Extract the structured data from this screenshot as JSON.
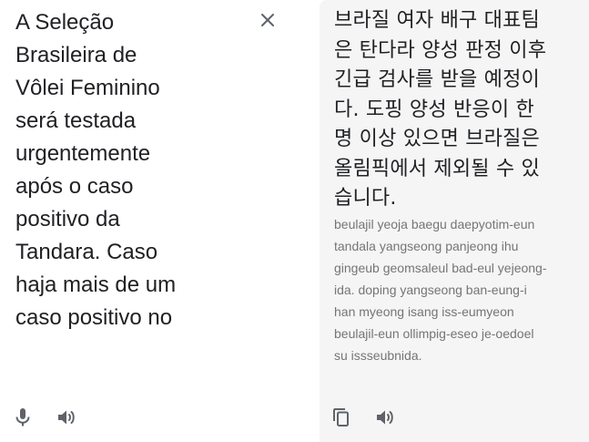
{
  "source": {
    "text": "A Seleção\nBrasileira de\nVôlei Feminino\nserá testada\nurgentemente\napós o caso\npositivo da\nTandara. Caso\nhaja mais de um\ncaso positivo no",
    "clear_icon": "close-icon",
    "mic_icon": "microphone-icon",
    "listen_icon": "speaker-icon"
  },
  "target": {
    "text": "브라질 여자 배구 대표팀\n은 탄다라 양성 판정 이후\n긴급 검사를 받을 예정이\n다. 도핑 양성 반응이 한\n명 이상 있으면 브라질은\n올림픽에서 제외될 수 있\n습니다.",
    "romanization": "beulajil yeoja baegu daepyotim-eun\ntandala yangseong panjeong ihu\ngingeub geomsaleul bad-eul yejeong-\nida. doping yangseong ban-eung-i\nhan myeong isang iss-eumyeon\nbeulajil-eun ollimpig-eseo je-oedoel\nsu issseubnida.",
    "copy_icon": "copy-icon",
    "listen_icon": "speaker-icon"
  },
  "colors": {
    "icon": "#5f6368",
    "target_bg": "#f5f5f5",
    "text": "#202124",
    "romanization": "#757575"
  }
}
